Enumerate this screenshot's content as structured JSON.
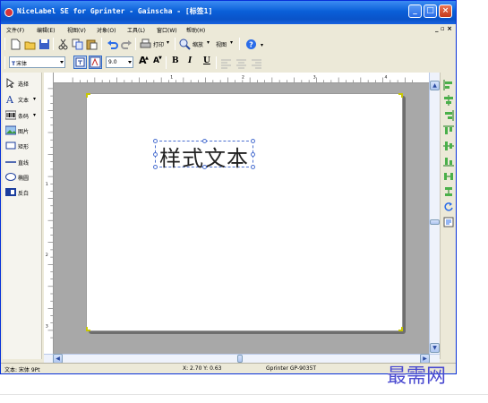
{
  "window": {
    "title": "NiceLabel SE for Gprinter - Gainscha - [标签1]",
    "minimize_glyph": "_",
    "maximize_glyph": "□",
    "close_glyph": "×"
  },
  "menu": {
    "items": [
      {
        "label": "文件(F)"
      },
      {
        "label": "编辑(E)"
      },
      {
        "label": "视图(V)"
      },
      {
        "label": "对象(O)"
      },
      {
        "label": "工具(L)"
      },
      {
        "label": "窗口(W)"
      },
      {
        "label": "帮助(H)"
      }
    ],
    "doc_controls": "_ ▫ ×"
  },
  "toolbar1": {
    "print_label": "打印",
    "zoom_label": "缩放",
    "view_label": "视图"
  },
  "toolbar2": {
    "font_name": "宋体",
    "font_size": "9.0",
    "grow_font": "A",
    "shrink_font": "A",
    "bold": "B",
    "italic": "I",
    "underline": "U"
  },
  "tools": [
    {
      "label": "选择",
      "icon": "pointer-icon"
    },
    {
      "label": "文本",
      "icon": "text-tool-icon"
    },
    {
      "label": "条码",
      "icon": "barcode-icon"
    },
    {
      "label": "图片",
      "icon": "picture-icon"
    },
    {
      "label": "矩形",
      "icon": "rectangle-icon"
    },
    {
      "label": "直线",
      "icon": "line-icon"
    },
    {
      "label": "椭圆",
      "icon": "ellipse-icon"
    },
    {
      "label": "反白",
      "icon": "inverse-icon"
    }
  ],
  "ruler": {
    "h_marks": [
      "1",
      "2",
      "3",
      "4"
    ],
    "v_marks": [
      "1",
      "2",
      "3"
    ]
  },
  "canvas": {
    "text_object": "样式文本"
  },
  "status": {
    "font": "文本: 宋体 9Pt",
    "coords": "X: 2.70 Y: 0.63",
    "printer": "Gprinter GP-9035T"
  },
  "watermark": "最需网",
  "colors": {
    "titlebar": "#0a5fd8",
    "selection": "#4a6fd0",
    "watermark": "#4a4ad0"
  }
}
